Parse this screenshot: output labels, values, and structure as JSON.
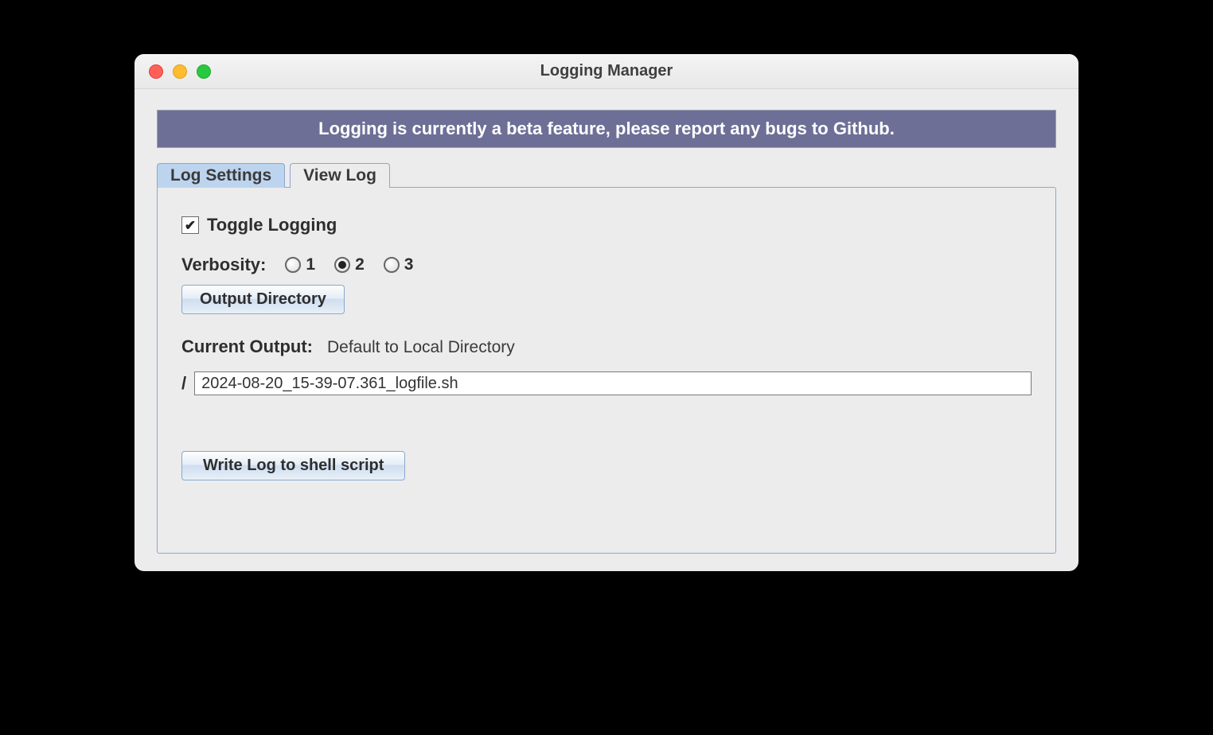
{
  "window": {
    "title": "Logging Manager"
  },
  "banner": {
    "text": "Logging is currently a beta feature, please report any bugs to Github."
  },
  "tabs": {
    "log_settings": "Log Settings",
    "view_log": "View Log"
  },
  "settings": {
    "toggle_label": "Toggle Logging",
    "toggle_checked": true,
    "verbosity_label": "Verbosity:",
    "verbosity_options": {
      "v1": "1",
      "v2": "2",
      "v3": "3"
    },
    "verbosity_selected": "2",
    "output_dir_button": "Output Directory",
    "current_output_label": "Current Output:",
    "current_output_value": "Default to Local Directory",
    "path_prefix": "/",
    "path_value": "2024-08-20_15-39-07.361_logfile.sh",
    "write_button": "Write Log to shell script"
  }
}
